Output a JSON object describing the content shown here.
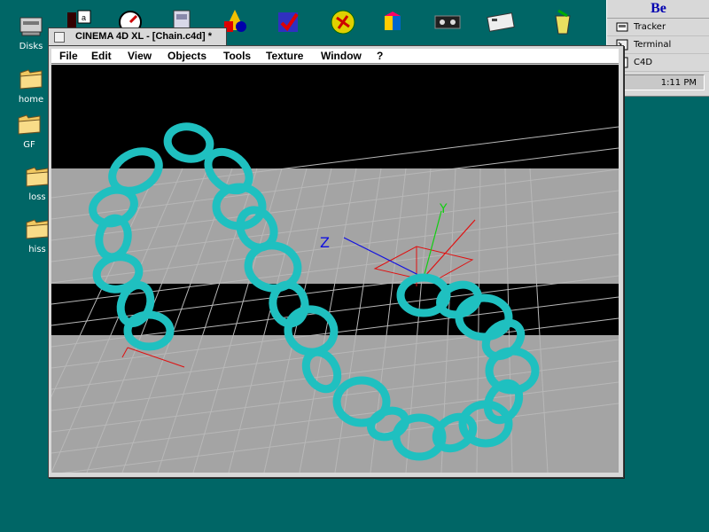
{
  "desktop_icons": [
    {
      "label": "Disks",
      "icon": "disks-icon"
    },
    {
      "label": "home",
      "icon": "folder-icon"
    },
    {
      "label": "GF",
      "icon": "folder-icon"
    },
    {
      "label": "loss",
      "icon": "folder-icon"
    },
    {
      "label": "hiss",
      "icon": "folder-icon"
    }
  ],
  "top_icons": [
    "app-icon-1",
    "app-icon-2",
    "app-icon-3",
    "app-icon-4",
    "app-icon-5",
    "app-icon-6",
    "app-icon-7",
    "app-icon-8",
    "app-icon-9",
    "app-icon-10",
    "app-icon-11"
  ],
  "deskbar": {
    "logo": "Be",
    "items": [
      {
        "label": "Tracker",
        "icon": "tracker-icon"
      },
      {
        "label": "Terminal",
        "icon": "terminal-icon"
      },
      {
        "label": "C4D",
        "icon": "c4d-icon"
      }
    ],
    "clock": "1:11 PM"
  },
  "window": {
    "title": "CINEMA 4D XL - [Chain.c4d] *",
    "menu": [
      "File",
      "Edit",
      "View",
      "Objects",
      "Tools",
      "Texture",
      "Window",
      "?"
    ]
  },
  "viewport": {
    "axis_labels": {
      "y": "Y",
      "z": "Z"
    },
    "colors": {
      "chain": "#1fc0c0",
      "grid": "#a0a0a0",
      "x_axis": "#e01010",
      "y_axis": "#10d010",
      "z_axis": "#1010e0"
    }
  }
}
